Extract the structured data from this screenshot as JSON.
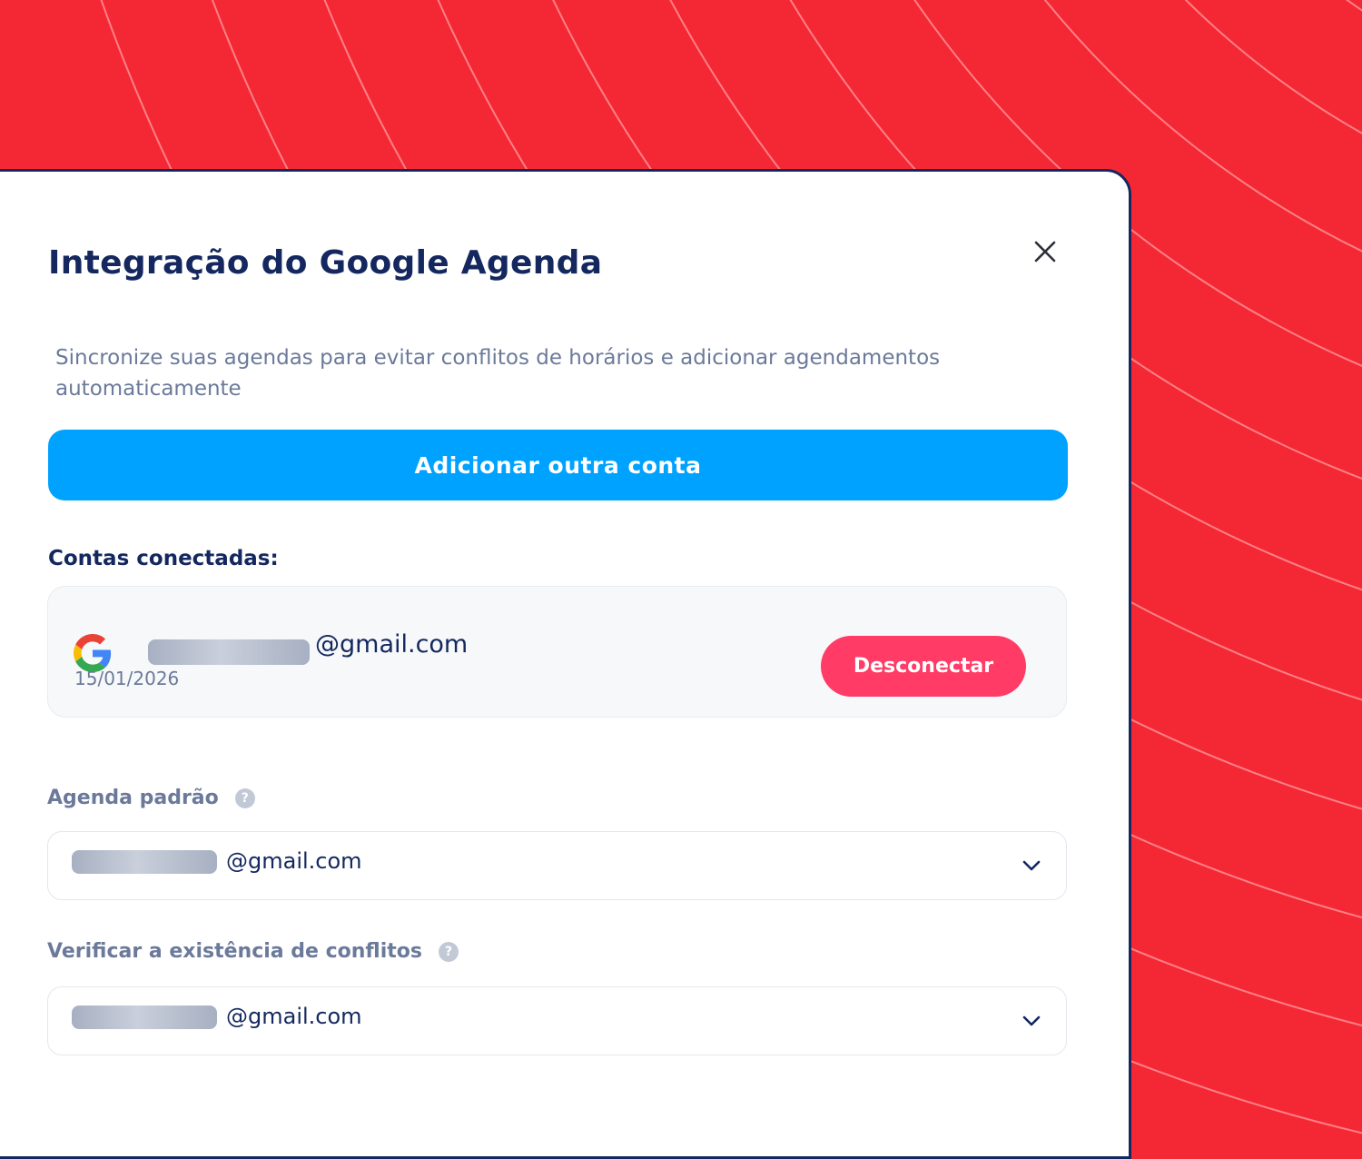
{
  "modal": {
    "title": "Integração do Google Agenda",
    "subtitle": "Sincronize suas agendas para evitar conflitos de horários e adicionar agendamentos automaticamente",
    "add_account_label": "Adicionar outra conta",
    "connected_label": "Contas conectadas:"
  },
  "account": {
    "email_suffix": "@gmail.com",
    "date": "15/01/2026",
    "disconnect_label": "Desconectar"
  },
  "default_calendar": {
    "label": "Agenda padrão",
    "help": "?",
    "value_suffix": "@gmail.com"
  },
  "conflicts": {
    "label": "Verificar a existência de conflitos",
    "help": "?",
    "value_suffix": "@gmail.com"
  },
  "colors": {
    "background": "#f42834",
    "primary": "#00a2ff",
    "danger": "#ff3b66",
    "heading": "#14285f"
  },
  "icons": [
    "close-icon",
    "google-icon",
    "help-icon",
    "chevron-down-icon"
  ]
}
